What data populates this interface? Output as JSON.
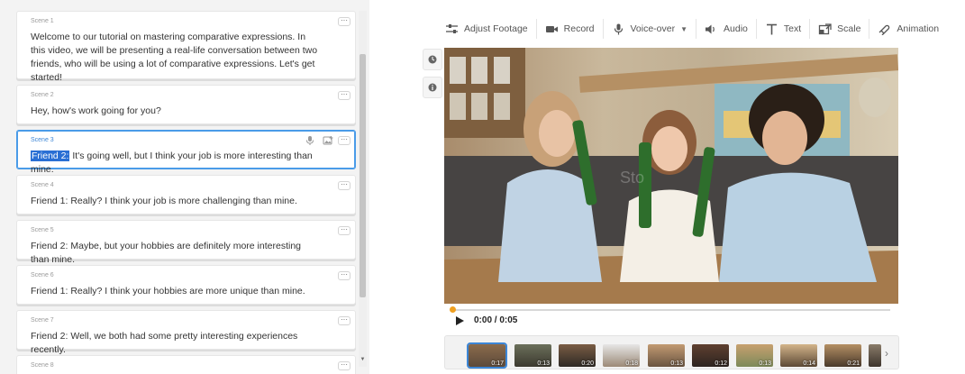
{
  "scenes": [
    {
      "label": "Scene 1",
      "text": "Welcome to our tutorial on mastering comparative expressions. In this video, we will be presenting a real-life conversation between two friends, who will be using a lot of comparative expressions. Let's get started!"
    },
    {
      "label": "Scene 2",
      "text": "Hey, how's work going for you?"
    },
    {
      "label": "Scene 3",
      "highlight": "Friend 2:",
      "text": " It's going well, but I think your job is more interesting than mine."
    },
    {
      "label": "Scene 4",
      "text": "Friend 1: Really? I think your job is more challenging than mine."
    },
    {
      "label": "Scene 5",
      "text": "Friend 2: Maybe, but your hobbies are definitely more interesting than mine."
    },
    {
      "label": "Scene 6",
      "text": "Friend 1: Really? I think your hobbies are more unique than mine."
    },
    {
      "label": "Scene 7",
      "text": "Friend 2: Well, we both had some pretty interesting experiences recently."
    },
    {
      "label": "Scene 8",
      "text": ""
    }
  ],
  "more_label": "···",
  "toolbar": {
    "adjust": "Adjust Footage",
    "record": "Record",
    "voiceover": "Voice-over",
    "audio": "Audio",
    "text": "Text",
    "scale": "Scale",
    "animation": "Animation"
  },
  "player": {
    "time": "0:00 / 0:05",
    "progress": 0.0,
    "watermark": "Sto"
  },
  "thumbnails": [
    {
      "dur": "0:17"
    },
    {
      "dur": "0:13"
    },
    {
      "dur": "0:20"
    },
    {
      "dur": "0:18"
    },
    {
      "dur": "0:13"
    },
    {
      "dur": "0:12"
    },
    {
      "dur": "0:13"
    },
    {
      "dur": "0:14"
    },
    {
      "dur": "0:21"
    },
    {
      "dur": ""
    }
  ],
  "colors": {
    "accent": "#3c86d6",
    "highlight": "#2a6fd4",
    "progress": "#f0a020"
  }
}
